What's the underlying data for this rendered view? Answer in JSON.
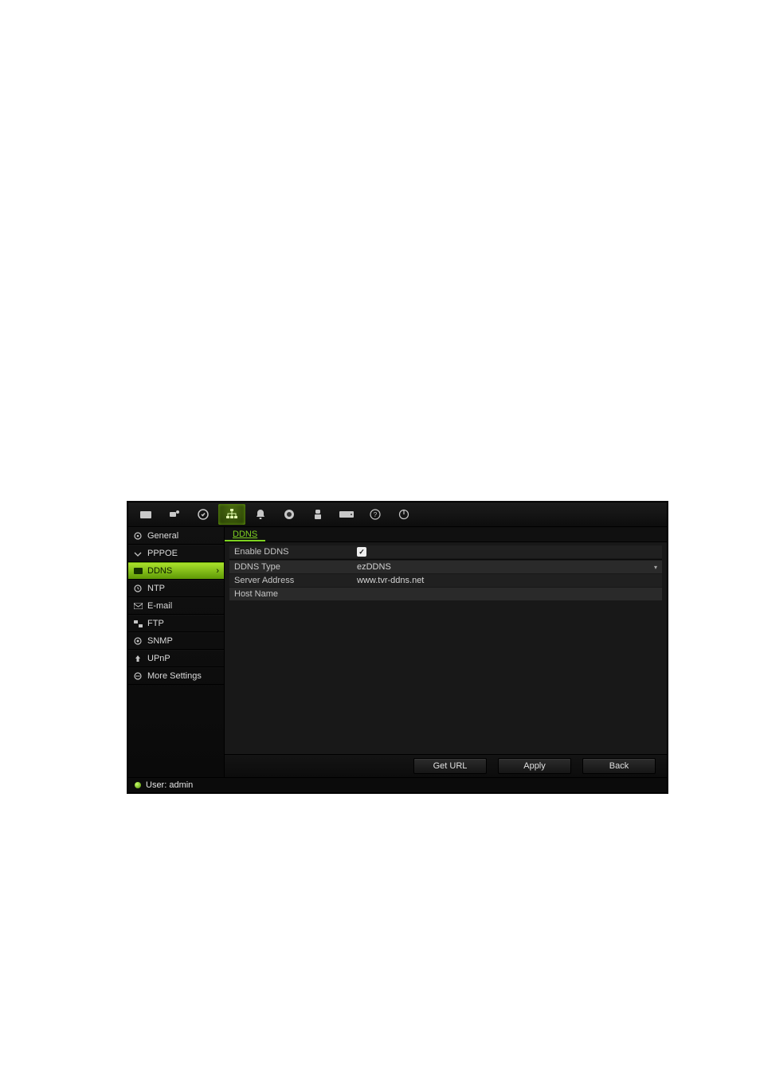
{
  "toolbar": {
    "items": [
      "camera",
      "camera-settings",
      "record",
      "network",
      "alarm",
      "dome",
      "user",
      "hdd",
      "help",
      "power"
    ],
    "active_index": 3
  },
  "sidebar": {
    "items": [
      {
        "label": "General"
      },
      {
        "label": "PPPOE"
      },
      {
        "label": "DDNS"
      },
      {
        "label": "NTP"
      },
      {
        "label": "E-mail"
      },
      {
        "label": "FTP"
      },
      {
        "label": "SNMP"
      },
      {
        "label": "UPnP"
      },
      {
        "label": "More Settings"
      }
    ],
    "active_index": 2
  },
  "main": {
    "tab_label": "DDNS",
    "fields": {
      "enable_ddns": {
        "label": "Enable DDNS",
        "checked": true
      },
      "ddns_type": {
        "label": "DDNS Type",
        "value": "ezDDNS"
      },
      "server_address": {
        "label": "Server Address",
        "value": "www.tvr-ddns.net"
      },
      "host_name": {
        "label": "Host Name",
        "value": ""
      }
    }
  },
  "buttons": {
    "get_url": "Get URL",
    "apply": "Apply",
    "back": "Back"
  },
  "status": {
    "user_label": "User: admin"
  }
}
